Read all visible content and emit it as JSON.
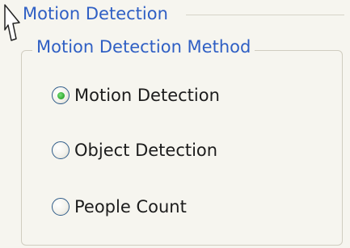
{
  "outer_group": {
    "title": "Motion Detection"
  },
  "method_group": {
    "title": "Motion Detection Method",
    "options": [
      {
        "label": "Motion Detection",
        "selected": true
      },
      {
        "label": "Object Detection",
        "selected": false
      },
      {
        "label": "People Count",
        "selected": false
      }
    ]
  },
  "colors": {
    "title_blue": "#2f5fc4",
    "background": "#f6f5ef",
    "selected_dot": "#2fa82f"
  },
  "icons": {
    "cursor": "mouse-pointer-icon"
  }
}
